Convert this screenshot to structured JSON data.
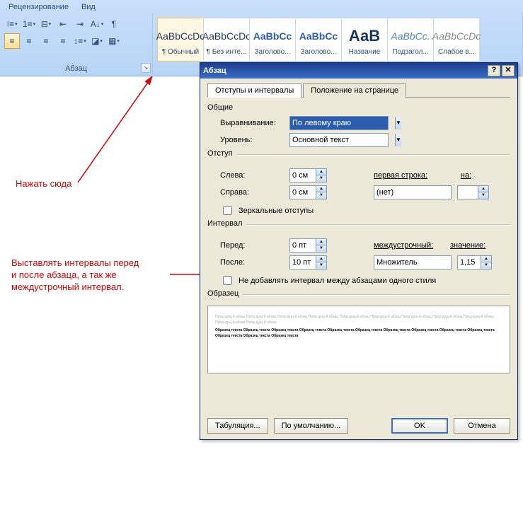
{
  "ribbon": {
    "tabs": [
      "Рецензирование",
      "Вид"
    ],
    "paragraph_group_label": "Абзац",
    "styles": [
      {
        "sample": "AaBbCcDc",
        "name": "¶ Обычный",
        "cls": ""
      },
      {
        "sample": "AaBbCcDc",
        "name": "¶ Без инте...",
        "cls": ""
      },
      {
        "sample": "AaBbCc",
        "name": "Заголово...",
        "cls": "blue"
      },
      {
        "sample": "AaBbCc",
        "name": "Заголово...",
        "cls": "blue"
      },
      {
        "sample": "АаВ",
        "name": "Название",
        "cls": "darkblue"
      },
      {
        "sample": "AaBbCc.",
        "name": "Подзагол...",
        "cls": "italic"
      },
      {
        "sample": "AaBbCcDc",
        "name": "Слабое в...",
        "cls": "gray"
      }
    ]
  },
  "annotations": {
    "click_here": "Нажать сюда",
    "interval_note_l1": "Выставлять интервалы перед",
    "interval_note_l2": "и после абзаца, а так же",
    "interval_note_l3": "междустрочный интервал."
  },
  "dialog": {
    "title": "Абзац",
    "tabs": {
      "t1": "Отступы и интервалы",
      "t2": "Положение на странице"
    },
    "general": {
      "label": "Общие",
      "align_label": "Выравнивание:",
      "align_value": "По левому краю",
      "level_label": "Уровень:",
      "level_value": "Основной текст"
    },
    "indent": {
      "label": "Отступ",
      "left_label": "Слева:",
      "left_value": "0 см",
      "right_label": "Справа:",
      "right_value": "0 см",
      "first_label": "первая строка:",
      "first_value": "(нет)",
      "on_label": "на:",
      "on_value": "",
      "mirror": "Зеркальные отступы"
    },
    "spacing": {
      "label": "Интервал",
      "before_label": "Перед:",
      "before_value": "0 пт",
      "after_label": "После:",
      "after_value": "10 пт",
      "line_label": "междустрочный:",
      "line_value": "Множитель",
      "val_label": "значение:",
      "val_value": "1,15",
      "same_style": "Не добавлять интервал между абзацами одного стиля"
    },
    "preview_label": "Образец",
    "preview_gray": "Пред-дущ-й абзац Пред-дущ-й абзац Пред-дущ-й абзац Пред-дущ-й абзац Пред-дущ-й абзац Пред-дущ-й абзац Пред-дущ-й абзац Пред-дущ-й абзац Пред-дущ-й абзац Пред-дущ-й абзац Пред-дущ-й абзац",
    "preview_dark": "Образец текста Образец текста Образец текста Образец текста Образец текста Образец текста Образец текста Образец текста Образец текста Образец текста Образец текста Образец текста Образец текста",
    "buttons": {
      "tabs": "Табуляция...",
      "default": "По умолчанию...",
      "ok": "OK",
      "cancel": "Отмена"
    }
  }
}
